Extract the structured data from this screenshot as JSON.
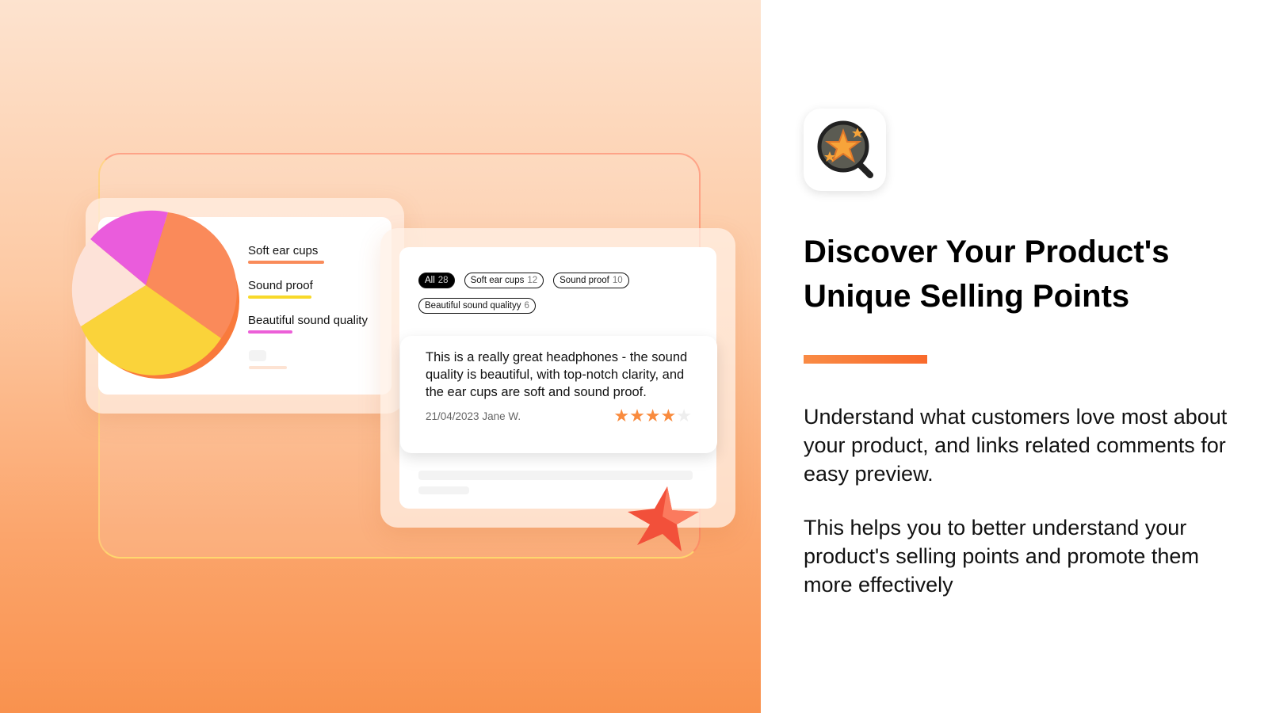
{
  "illustration": {
    "legend": [
      {
        "label": "Soft ear cups",
        "color": "#f98b5a"
      },
      {
        "label": "Sound proof",
        "color": "#f8d92a"
      },
      {
        "label": "Beautiful sound quality",
        "color": "#ec5fd8"
      }
    ],
    "chips": [
      {
        "label": "All",
        "count": "28",
        "active": true
      },
      {
        "label": "Soft ear cups",
        "count": "12"
      },
      {
        "label": "Sound proof",
        "count": "10"
      },
      {
        "label": "Beautiful sound qualityy",
        "count": "6"
      }
    ],
    "review": {
      "text": "This is a really great headphones - the sound quality is beautiful, with top-notch clarity, and the ear cups are soft and sound proof.",
      "date_author": "21/04/2023 Jane W.",
      "rating": 4,
      "max_rating": 5
    }
  },
  "headline": "Discover Your Product's Unique Selling Points",
  "paragraph1": "Understand what customers love most about your product, and links related comments for easy preview.",
  "paragraph2": "This helps you to better understand your product's selling points and promote them more effectively",
  "colors": {
    "accent": "#f97b38",
    "star": "#f98b3e"
  }
}
